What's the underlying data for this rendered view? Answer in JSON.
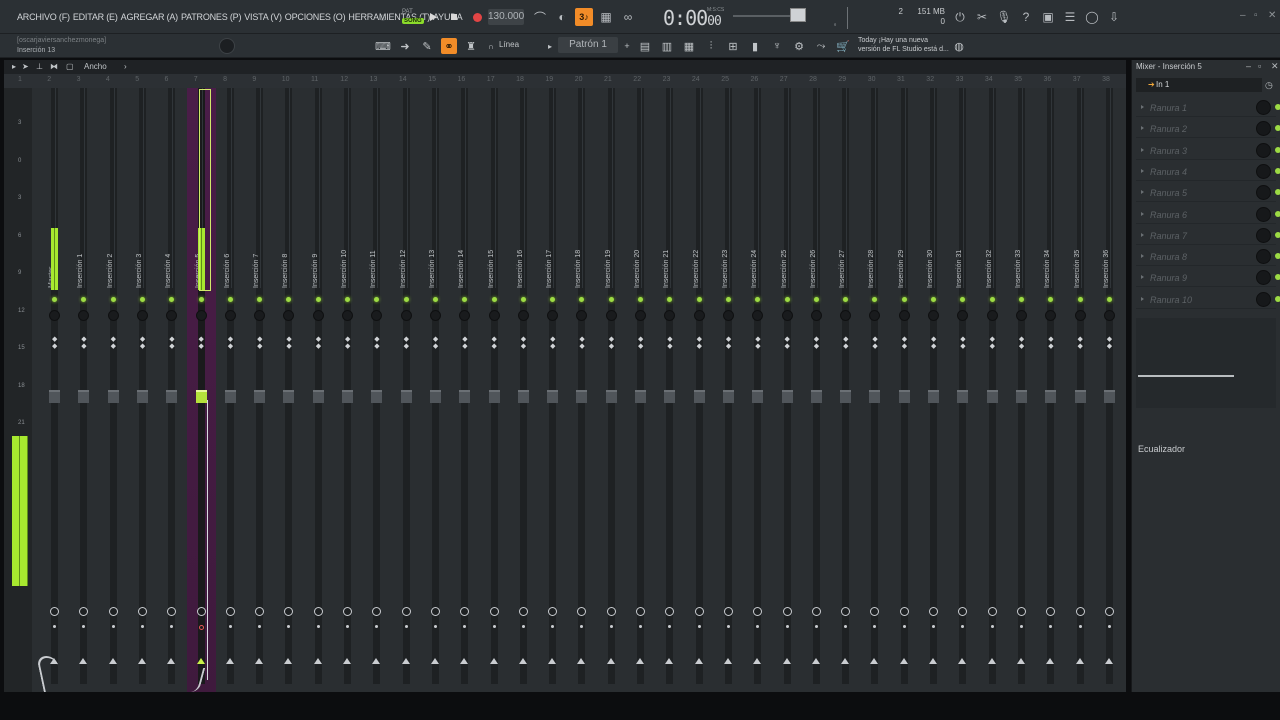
{
  "menu": [
    "ARCHIVO (F)",
    "EDITAR (E)",
    "AGREGAR (A)",
    "PATRONES (P)",
    "VISTA (V)",
    "OPCIONES (O)",
    "HERRAMIENTAS (T)",
    "AYUDA"
  ],
  "transport": {
    "pat_label": "PAT",
    "song_label": "SONG",
    "tempo": "130.000",
    "time_main": "0:00",
    "time_sub": "00",
    "time_unit": "M:S:CS"
  },
  "top_right": {
    "cpu_value": "2",
    "mem_value": "151 MB",
    "mem_sub": "0"
  },
  "hint": {
    "user": "[oscarjaviersanchezmonega]",
    "insert": "Inserción 13"
  },
  "toolbar2": {
    "linea": "Línea",
    "patron": "Patrón 1"
  },
  "news": {
    "line1": "Today  ¡Hay una nueva",
    "line2": "versión de FL Studio está d..."
  },
  "mixer_header": {
    "width_label": "Ancho"
  },
  "ruler": [
    "1",
    "2",
    "3",
    "4",
    "5",
    "6",
    "7",
    "8",
    "9",
    "10",
    "11",
    "12",
    "13",
    "14",
    "15",
    "16",
    "17",
    "18",
    "19",
    "20",
    "21",
    "22",
    "23",
    "24",
    "25",
    "26",
    "27",
    "28",
    "29",
    "30",
    "31",
    "32",
    "33",
    "34",
    "35",
    "36",
    "37",
    "38"
  ],
  "db_scale": [
    "3",
    "0",
    "3",
    "6",
    "9",
    "12",
    "15",
    "18",
    "21"
  ],
  "strips": [
    {
      "name": "Master"
    },
    {
      "name": "Inserción 1"
    },
    {
      "name": "Inserción 2"
    },
    {
      "name": "Inserción 3"
    },
    {
      "name": "Inserción 4"
    },
    {
      "name": "Inserción 5"
    },
    {
      "name": "Inserción 6"
    },
    {
      "name": "Inserción 7"
    },
    {
      "name": "Inserción 8"
    },
    {
      "name": "Inserción 9"
    },
    {
      "name": "Inserción 10"
    },
    {
      "name": "Inserción 11"
    },
    {
      "name": "Inserción 12"
    },
    {
      "name": "Inserción 13"
    },
    {
      "name": "Inserción 14"
    },
    {
      "name": "Inserción 15"
    },
    {
      "name": "Inserción 16"
    },
    {
      "name": "Inserción 17"
    },
    {
      "name": "Inserción 18"
    },
    {
      "name": "Inserción 19"
    },
    {
      "name": "Inserción 20"
    },
    {
      "name": "Inserción 21"
    },
    {
      "name": "Inserción 22"
    },
    {
      "name": "Inserción 23"
    },
    {
      "name": "Inserción 24"
    },
    {
      "name": "Inserción 25"
    },
    {
      "name": "Inserción 26"
    },
    {
      "name": "Inserción 27"
    },
    {
      "name": "Inserción 28"
    },
    {
      "name": "Inserción 29"
    },
    {
      "name": "Inserción 30"
    },
    {
      "name": "Inserción 31"
    },
    {
      "name": "Inserción 32"
    },
    {
      "name": "Inserción 33"
    },
    {
      "name": "Inserción 34"
    },
    {
      "name": "Inserción 35"
    },
    {
      "name": "Inserción 36"
    }
  ],
  "selected_strip": "Inserción 5",
  "right_panel": {
    "title": "Mixer - Inserción 5",
    "input": "In 1",
    "slots": [
      "Ranura 1",
      "Ranura 2",
      "Ranura 3",
      "Ranura 4",
      "Ranura 5",
      "Ranura 6",
      "Ranura 7",
      "Ranura 8",
      "Ranura 9",
      "Ranura 10"
    ],
    "eq_label": "Ecualizador"
  },
  "colors": {
    "accent_orange": "#f28c28",
    "meter_green": "#a7e82f",
    "selected_strip": "#4a1d48",
    "record_red": "#e24545"
  }
}
